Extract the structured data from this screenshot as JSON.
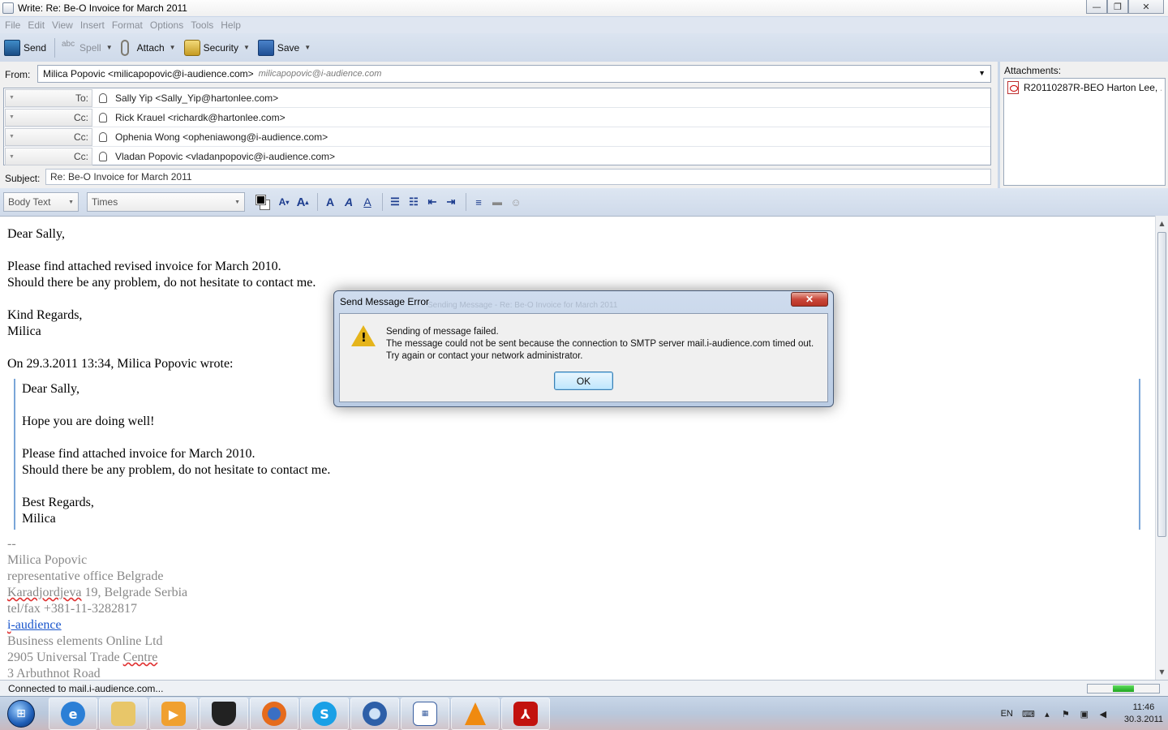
{
  "window": {
    "title": "Write: Re: Be-O Invoice for March 2011",
    "minimize": "—",
    "maximize": "❐",
    "close": "✕"
  },
  "menu": [
    "File",
    "Edit",
    "View",
    "Insert",
    "Format",
    "Options",
    "Tools",
    "Help"
  ],
  "toolbar": {
    "send": "Send",
    "spell": "Spell",
    "attach": "Attach",
    "security": "Security",
    "save": "Save"
  },
  "header": {
    "from_label": "From:",
    "from_name": "Milica Popovic <milicapopovic@i-audience.com>",
    "from_account": "milicapopovic@i-audience.com",
    "recipients": [
      {
        "type": "To:",
        "address": "Sally Yip <Sally_Yip@hartonlee.com>"
      },
      {
        "type": "Cc:",
        "address": "Rick Krauel <richardk@hartonlee.com>"
      },
      {
        "type": "Cc:",
        "address": "Ophenia Wong <opheniawong@i-audience.com>"
      },
      {
        "type": "Cc:",
        "address": "Vladan Popovic <vladanpopovic@i-audience.com>"
      }
    ],
    "subject_label": "Subject:",
    "subject": "Re: Be-O Invoice for March 2011"
  },
  "attachments": {
    "label": "Attachments:",
    "items": [
      "R20110287R-BEO Harton Lee, ..."
    ]
  },
  "format": {
    "paragraph": "Body Text",
    "font": "Times"
  },
  "body": {
    "lines": [
      "Dear Sally,",
      "Please find attached revised invoice for March 2010.",
      "Should there be any problem, do not hesitate to contact me.",
      "Kind Regards,",
      "Milica",
      "On 29.3.2011 13:34, Milica Popovic wrote:"
    ],
    "quote": [
      "Dear Sally,",
      "Hope you are doing well!",
      "Please find attached invoice for March 2010.",
      "Should there be any problem, do not hesitate to contact me.",
      "Best Regards,",
      "Milica"
    ],
    "signature": {
      "sep": "--",
      "name": "Milica Popovic",
      "office": "representative office Belgrade",
      "address_word": "Karadjordjeva",
      "address_rest": " 19, Belgrade Serbia",
      "phone": "tel/fax +381-11-3282817",
      "link_i": "i",
      "link_rest": "-audience",
      "company": "Business elements Online Ltd",
      "centre_1": "2905 Universal Trade ",
      "centre_2": "Centre",
      "road": "3 Arbuthnot Road"
    }
  },
  "status": {
    "text": "Connected to mail.i-audience.com...",
    "progress": 0.3
  },
  "dialog": {
    "title": "Send Message Error",
    "ghost_title": "Sending Message - Re: Be-O Invoice for March 2011",
    "heading": "Sending of message failed.",
    "message": "The message could not be sent because the connection to SMTP server mail.i-audience.com timed out. Try again or contact your network administrator.",
    "ok": "OK",
    "close": "✕"
  },
  "taskbar": {
    "lang": "EN",
    "time": "11:46",
    "date": "30.3.2011"
  }
}
